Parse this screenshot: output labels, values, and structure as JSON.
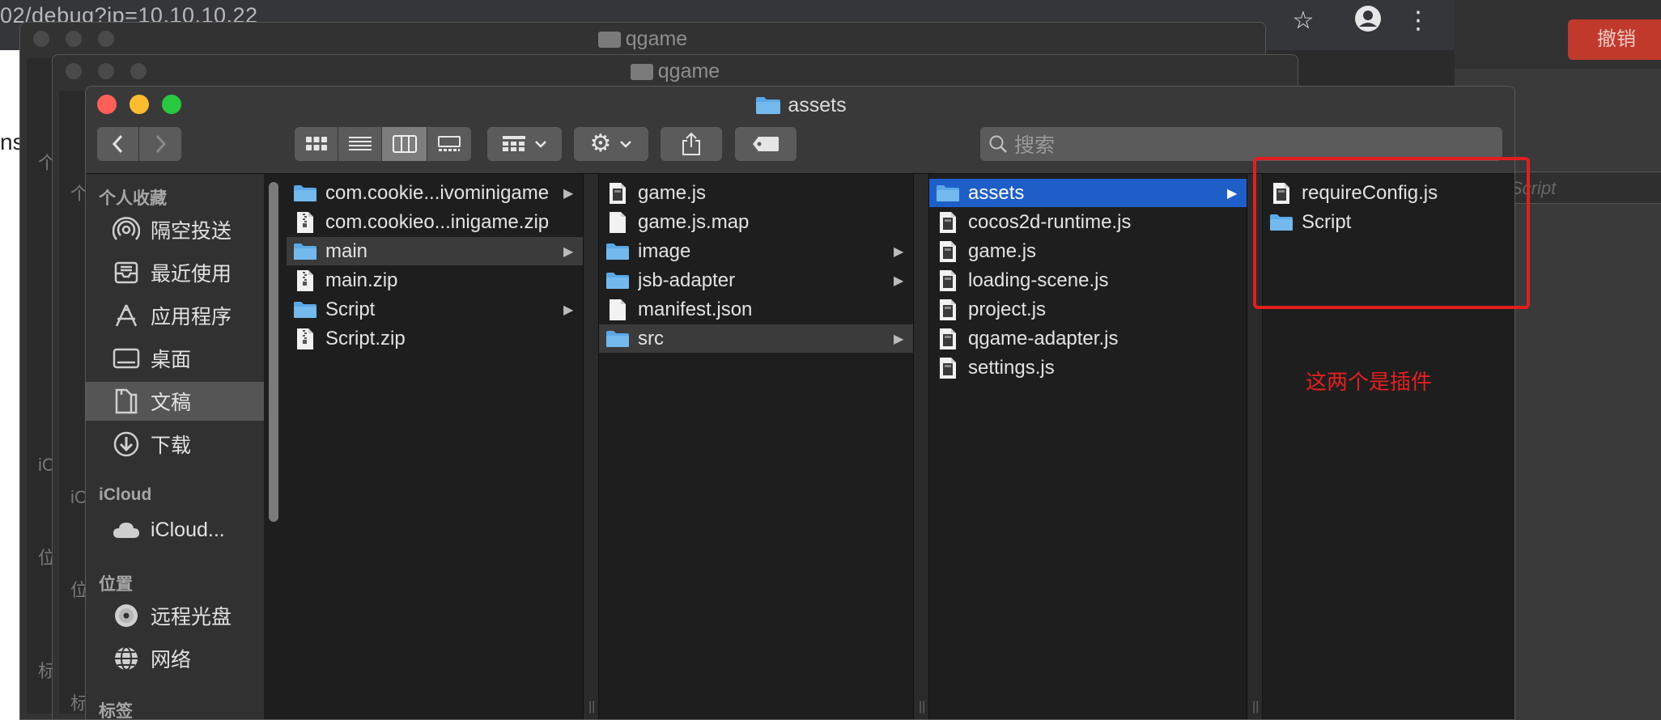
{
  "browser": {
    "url_text": "02/debug?ip=10.10.10.22",
    "left_strip_texts": [
      "ns",
      "个",
      "个",
      "iC",
      "iC",
      "位",
      "位",
      "标",
      "标"
    ],
    "revoke_button": "撤销",
    "right_field_placeholder": "Script"
  },
  "back_windows": [
    {
      "title": "qgame"
    },
    {
      "title": "qgame"
    }
  ],
  "finder": {
    "title": "assets",
    "search_placeholder": "搜索",
    "sidebar": {
      "favorites_header": "个人收藏",
      "favorites": [
        {
          "label": "隔空投送",
          "icon": "airdrop-icon"
        },
        {
          "label": "最近使用",
          "icon": "recents-icon"
        },
        {
          "label": "应用程序",
          "icon": "applications-icon"
        },
        {
          "label": "桌面",
          "icon": "desktop-icon"
        },
        {
          "label": "文稿",
          "icon": "documents-icon",
          "active": true
        },
        {
          "label": "下载",
          "icon": "downloads-icon"
        }
      ],
      "icloud_header": "iCloud",
      "icloud": [
        {
          "label": "iCloud...",
          "icon": "icloud-icon"
        }
      ],
      "locations_header": "位置",
      "locations": [
        {
          "label": "远程光盘",
          "icon": "disc-icon"
        },
        {
          "label": "网络",
          "icon": "network-icon"
        }
      ],
      "tags_header": "标签"
    },
    "columns": [
      {
        "items": [
          {
            "name": "com.cookie...ivominigame",
            "kind": "folder",
            "arrow": true
          },
          {
            "name": "com.cookieo...inigame.zip",
            "kind": "zip"
          },
          {
            "name": "main",
            "kind": "folder",
            "arrow": true,
            "selected": "grey"
          },
          {
            "name": "main.zip",
            "kind": "zip"
          },
          {
            "name": "Script",
            "kind": "folder",
            "arrow": true
          },
          {
            "name": "Script.zip",
            "kind": "zip"
          }
        ]
      },
      {
        "items": [
          {
            "name": "game.js",
            "kind": "js"
          },
          {
            "name": "game.js.map",
            "kind": "file"
          },
          {
            "name": "image",
            "kind": "folder",
            "arrow": true
          },
          {
            "name": "jsb-adapter",
            "kind": "folder",
            "arrow": true
          },
          {
            "name": "manifest.json",
            "kind": "file"
          },
          {
            "name": "src",
            "kind": "folder",
            "arrow": true,
            "selected": "grey"
          }
        ]
      },
      {
        "items": [
          {
            "name": "assets",
            "kind": "folder",
            "arrow": true,
            "selected": "blue"
          },
          {
            "name": "cocos2d-runtime.js",
            "kind": "js"
          },
          {
            "name": "game.js",
            "kind": "js"
          },
          {
            "name": "loading-scene.js",
            "kind": "js"
          },
          {
            "name": "project.js",
            "kind": "js"
          },
          {
            "name": "qgame-adapter.js",
            "kind": "js"
          },
          {
            "name": "settings.js",
            "kind": "js"
          }
        ]
      },
      {
        "items": [
          {
            "name": "requireConfig.js",
            "kind": "js"
          },
          {
            "name": "Script",
            "kind": "folder"
          }
        ]
      }
    ]
  },
  "annotation": {
    "text": "这两个是插件",
    "color": "#e61e1e"
  },
  "colors": {
    "selection_blue": "#1e5ec8",
    "folder_blue": "#5aa9e6",
    "close": "#fe5f57",
    "minimize": "#febc2e",
    "zoom": "#28c840"
  }
}
